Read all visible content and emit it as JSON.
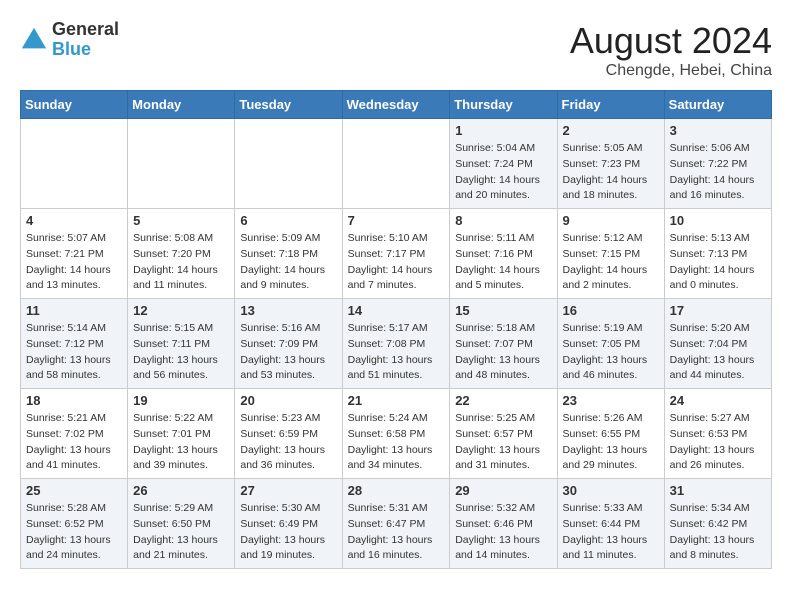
{
  "header": {
    "logo_general": "General",
    "logo_blue": "Blue",
    "month_title": "August 2024",
    "location": "Chengde, Hebei, China"
  },
  "weekdays": [
    "Sunday",
    "Monday",
    "Tuesday",
    "Wednesday",
    "Thursday",
    "Friday",
    "Saturday"
  ],
  "weeks": [
    [
      {
        "day": "",
        "info": ""
      },
      {
        "day": "",
        "info": ""
      },
      {
        "day": "",
        "info": ""
      },
      {
        "day": "",
        "info": ""
      },
      {
        "day": "1",
        "info": "Sunrise: 5:04 AM\nSunset: 7:24 PM\nDaylight: 14 hours\nand 20 minutes."
      },
      {
        "day": "2",
        "info": "Sunrise: 5:05 AM\nSunset: 7:23 PM\nDaylight: 14 hours\nand 18 minutes."
      },
      {
        "day": "3",
        "info": "Sunrise: 5:06 AM\nSunset: 7:22 PM\nDaylight: 14 hours\nand 16 minutes."
      }
    ],
    [
      {
        "day": "4",
        "info": "Sunrise: 5:07 AM\nSunset: 7:21 PM\nDaylight: 14 hours\nand 13 minutes."
      },
      {
        "day": "5",
        "info": "Sunrise: 5:08 AM\nSunset: 7:20 PM\nDaylight: 14 hours\nand 11 minutes."
      },
      {
        "day": "6",
        "info": "Sunrise: 5:09 AM\nSunset: 7:18 PM\nDaylight: 14 hours\nand 9 minutes."
      },
      {
        "day": "7",
        "info": "Sunrise: 5:10 AM\nSunset: 7:17 PM\nDaylight: 14 hours\nand 7 minutes."
      },
      {
        "day": "8",
        "info": "Sunrise: 5:11 AM\nSunset: 7:16 PM\nDaylight: 14 hours\nand 5 minutes."
      },
      {
        "day": "9",
        "info": "Sunrise: 5:12 AM\nSunset: 7:15 PM\nDaylight: 14 hours\nand 2 minutes."
      },
      {
        "day": "10",
        "info": "Sunrise: 5:13 AM\nSunset: 7:13 PM\nDaylight: 14 hours\nand 0 minutes."
      }
    ],
    [
      {
        "day": "11",
        "info": "Sunrise: 5:14 AM\nSunset: 7:12 PM\nDaylight: 13 hours\nand 58 minutes."
      },
      {
        "day": "12",
        "info": "Sunrise: 5:15 AM\nSunset: 7:11 PM\nDaylight: 13 hours\nand 56 minutes."
      },
      {
        "day": "13",
        "info": "Sunrise: 5:16 AM\nSunset: 7:09 PM\nDaylight: 13 hours\nand 53 minutes."
      },
      {
        "day": "14",
        "info": "Sunrise: 5:17 AM\nSunset: 7:08 PM\nDaylight: 13 hours\nand 51 minutes."
      },
      {
        "day": "15",
        "info": "Sunrise: 5:18 AM\nSunset: 7:07 PM\nDaylight: 13 hours\nand 48 minutes."
      },
      {
        "day": "16",
        "info": "Sunrise: 5:19 AM\nSunset: 7:05 PM\nDaylight: 13 hours\nand 46 minutes."
      },
      {
        "day": "17",
        "info": "Sunrise: 5:20 AM\nSunset: 7:04 PM\nDaylight: 13 hours\nand 44 minutes."
      }
    ],
    [
      {
        "day": "18",
        "info": "Sunrise: 5:21 AM\nSunset: 7:02 PM\nDaylight: 13 hours\nand 41 minutes."
      },
      {
        "day": "19",
        "info": "Sunrise: 5:22 AM\nSunset: 7:01 PM\nDaylight: 13 hours\nand 39 minutes."
      },
      {
        "day": "20",
        "info": "Sunrise: 5:23 AM\nSunset: 6:59 PM\nDaylight: 13 hours\nand 36 minutes."
      },
      {
        "day": "21",
        "info": "Sunrise: 5:24 AM\nSunset: 6:58 PM\nDaylight: 13 hours\nand 34 minutes."
      },
      {
        "day": "22",
        "info": "Sunrise: 5:25 AM\nSunset: 6:57 PM\nDaylight: 13 hours\nand 31 minutes."
      },
      {
        "day": "23",
        "info": "Sunrise: 5:26 AM\nSunset: 6:55 PM\nDaylight: 13 hours\nand 29 minutes."
      },
      {
        "day": "24",
        "info": "Sunrise: 5:27 AM\nSunset: 6:53 PM\nDaylight: 13 hours\nand 26 minutes."
      }
    ],
    [
      {
        "day": "25",
        "info": "Sunrise: 5:28 AM\nSunset: 6:52 PM\nDaylight: 13 hours\nand 24 minutes."
      },
      {
        "day": "26",
        "info": "Sunrise: 5:29 AM\nSunset: 6:50 PM\nDaylight: 13 hours\nand 21 minutes."
      },
      {
        "day": "27",
        "info": "Sunrise: 5:30 AM\nSunset: 6:49 PM\nDaylight: 13 hours\nand 19 minutes."
      },
      {
        "day": "28",
        "info": "Sunrise: 5:31 AM\nSunset: 6:47 PM\nDaylight: 13 hours\nand 16 minutes."
      },
      {
        "day": "29",
        "info": "Sunrise: 5:32 AM\nSunset: 6:46 PM\nDaylight: 13 hours\nand 14 minutes."
      },
      {
        "day": "30",
        "info": "Sunrise: 5:33 AM\nSunset: 6:44 PM\nDaylight: 13 hours\nand 11 minutes."
      },
      {
        "day": "31",
        "info": "Sunrise: 5:34 AM\nSunset: 6:42 PM\nDaylight: 13 hours\nand 8 minutes."
      }
    ]
  ]
}
